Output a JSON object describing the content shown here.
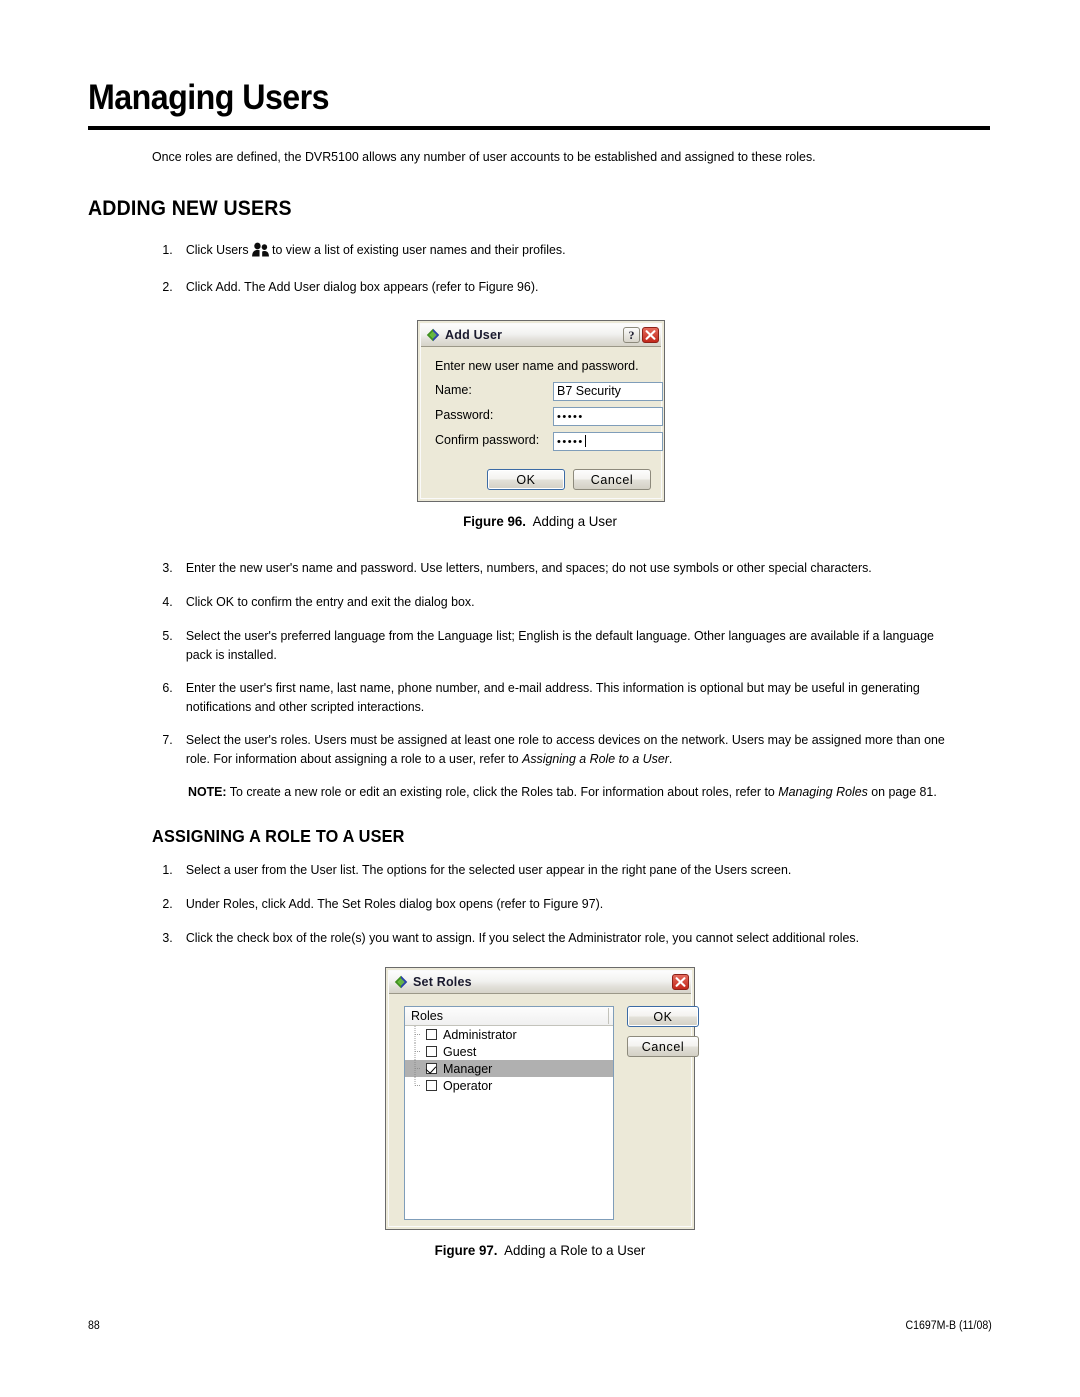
{
  "page": {
    "title": "Managing Users",
    "intro": "Once roles are defined, the DVR5100 allows any number of user accounts to be established and assigned to these roles.",
    "footer_page_number": "88",
    "footer_doc_id": "C1697M-B (11/08)"
  },
  "sections": {
    "adding_new_users": {
      "heading": "ADDING NEW USERS",
      "steps": [
        {
          "num": "1.",
          "pre": "Click Users",
          "icon": "users-icon",
          "post": "to view a list of existing user names and their profiles."
        },
        {
          "num": "2.",
          "text": "Click Add. The Add User dialog box appears (refer to Figure 96)."
        },
        {
          "num": "3.",
          "text": "Enter the new user's name and password. Use letters, numbers, and spaces; do not use symbols or other special characters."
        },
        {
          "num": "4.",
          "text": "Click OK to confirm the entry and exit the dialog box."
        },
        {
          "num": "5.",
          "text": "Select the user's preferred language from the Language list; English is the default language. Other languages are available if a language pack is installed."
        },
        {
          "num": "6.",
          "text": "Enter the user's first name, last name, phone number, and e-mail address. This information is optional but may be useful in generating notifications and other scripted interactions."
        },
        {
          "num": "7.",
          "pre": "Select the user's roles. Users must be assigned at least one role to access devices on the network. Users may be assigned more than one role. For information about assigning a role to a user, refer to ",
          "italic": "Assigning a Role to a User",
          "post": "."
        }
      ]
    },
    "note": {
      "label": "NOTE:",
      "pre": " To create a new role or edit an existing role, click the Roles tab. For information about roles, refer to ",
      "italic": "Managing Roles",
      "post": " on page 81."
    },
    "assigning_role": {
      "heading": "ASSIGNING A ROLE TO A USER",
      "steps": [
        {
          "num": "1.",
          "text": "Select a user from the User list. The options for the selected user appear in the right pane of the Users screen."
        },
        {
          "num": "2.",
          "text": "Under Roles, click Add. The Set Roles dialog box opens (refer to Figure 97)."
        },
        {
          "num": "3.",
          "text": "Click the check box of the role(s) you want to assign. If you select the Administrator role, you cannot select additional roles."
        }
      ]
    }
  },
  "figures": {
    "fig96": {
      "label": "Figure 96.",
      "caption": "Adding a User"
    },
    "fig97": {
      "label": "Figure 97.",
      "caption": "Adding a Role to a User"
    }
  },
  "add_user_dialog": {
    "title": "Add User",
    "app_icon": "diamond-icon",
    "help_button": "?",
    "close_button": "close-icon",
    "prompt": "Enter new user name and password.",
    "fields": [
      {
        "label": "Name:",
        "value": "B7 Security",
        "masked": false
      },
      {
        "label": "Password:",
        "value": "•••••",
        "masked": true
      },
      {
        "label": "Confirm password:",
        "value": "•••••",
        "masked": true
      }
    ],
    "ok_label": "OK",
    "cancel_label": "Cancel"
  },
  "set_roles_dialog": {
    "title": "Set Roles",
    "app_icon": "diamond-icon",
    "close_button": "close-icon",
    "list_header": "Roles",
    "roles": [
      {
        "label": "Administrator",
        "checked": false,
        "selected": false
      },
      {
        "label": "Guest",
        "checked": false,
        "selected": false
      },
      {
        "label": "Manager",
        "checked": true,
        "selected": true
      },
      {
        "label": "Operator",
        "checked": false,
        "selected": false
      }
    ],
    "ok_label": "OK",
    "cancel_label": "Cancel"
  },
  "colors": {
    "dialog_face": "#ece9d8",
    "titlebar_top": "#fdfdfd",
    "titlebar_bottom": "#d6d3c8",
    "close_red": "#c2281b",
    "field_border": "#7f9db9",
    "selection_gray": "#b0b0b0",
    "diamond_green": "#4aa02c",
    "diamond_blue": "#2b3fae"
  }
}
